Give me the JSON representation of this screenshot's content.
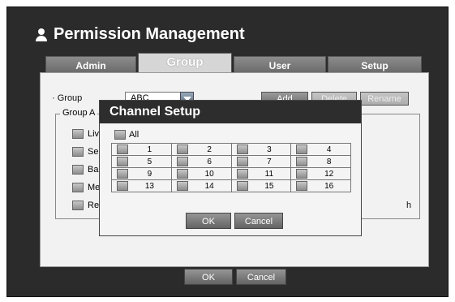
{
  "title": "Permission Management",
  "tabs": [
    {
      "label": "Admin",
      "active": false
    },
    {
      "label": "Group",
      "active": true
    },
    {
      "label": "User",
      "active": false
    },
    {
      "label": "Setup",
      "active": false
    }
  ],
  "group": {
    "label": "· Group",
    "value": "ABC",
    "add_label": "Add",
    "delete_label": "Delete",
    "rename_label": "Rename"
  },
  "auth": {
    "legend": "Group A",
    "items": [
      "Live",
      "Sear",
      "Back",
      "Menu",
      "Reco"
    ],
    "right_fragment": "h"
  },
  "dialog": {
    "title": "Channel Setup",
    "all_label": "All",
    "channels": [
      "1",
      "2",
      "3",
      "4",
      "5",
      "6",
      "7",
      "8",
      "9",
      "10",
      "11",
      "12",
      "13",
      "14",
      "15",
      "16"
    ],
    "ok_label": "OK",
    "cancel_label": "Cancel"
  },
  "footer": {
    "ok_label": "OK",
    "cancel_label": "Cancel"
  },
  "colors": {
    "frame": "#2b2b2b",
    "panel": "#f2f2f2",
    "tab_active": "#d6d6d6",
    "tab_inactive": "#7a7a7a"
  }
}
